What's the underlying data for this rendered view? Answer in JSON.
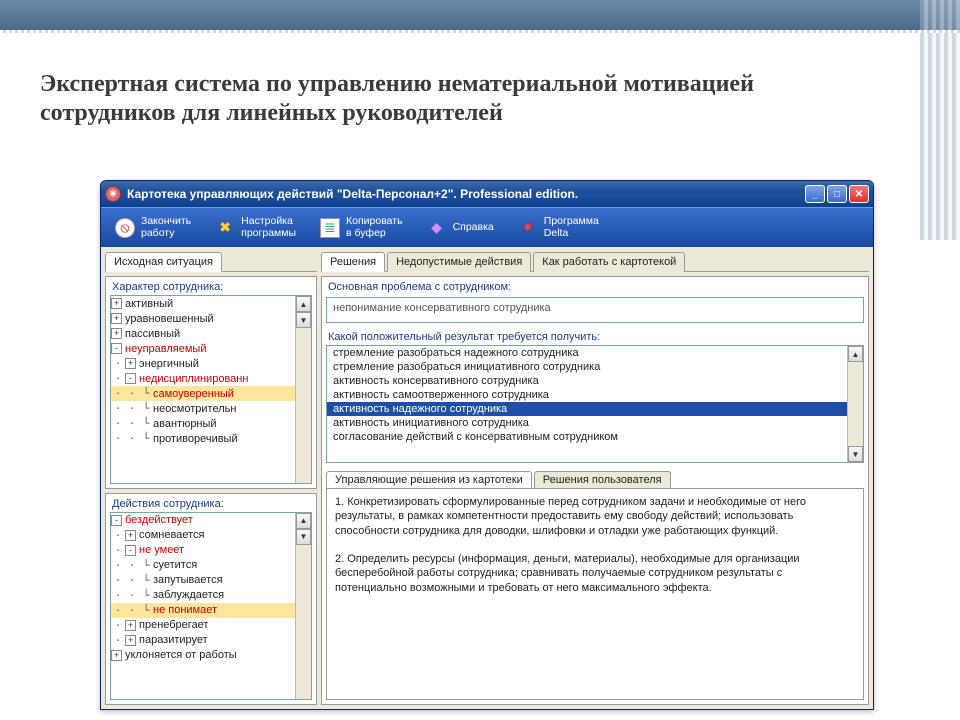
{
  "slide_title": "Экспертная система по управлению нематериальной мотивацией сотрудников для линейных руководителей",
  "window": {
    "title": "Картотека управляющих действий \"Delta-Персонал+2\". Professional edition.",
    "toolbar": [
      {
        "icon": "stop",
        "label": "Закончить\nработу"
      },
      {
        "icon": "gear",
        "label": "Настройка\nпрограммы"
      },
      {
        "icon": "doc",
        "label": "Копировать\nв буфер"
      },
      {
        "icon": "book",
        "label": "Справка"
      },
      {
        "icon": "star",
        "label": "Программа\nDelta"
      }
    ]
  },
  "left": {
    "tab": "Исходная ситуация",
    "sec1_label": "Характер сотрудника:",
    "tree1": [
      {
        "d": 0,
        "e": "+",
        "t": "активный"
      },
      {
        "d": 0,
        "e": "+",
        "t": "уравновешенный"
      },
      {
        "d": 0,
        "e": "+",
        "t": "пассивный"
      },
      {
        "d": 0,
        "e": "-",
        "t": "неуправляемый",
        "red": true
      },
      {
        "d": 1,
        "e": "+",
        "t": "энергичный"
      },
      {
        "d": 1,
        "e": "-",
        "t": "недисциплинированн",
        "red": true
      },
      {
        "d": 2,
        "e": "",
        "t": "самоуверенный",
        "sel": true,
        "red": true
      },
      {
        "d": 2,
        "e": "",
        "t": "неосмотрительн"
      },
      {
        "d": 2,
        "e": "",
        "t": "авантюрный"
      },
      {
        "d": 2,
        "e": "",
        "t": "противоречивый"
      }
    ],
    "sec2_label": "Действия сотрудника:",
    "tree2": [
      {
        "d": 0,
        "e": "-",
        "t": "бездействует",
        "red": true
      },
      {
        "d": 1,
        "e": "+",
        "t": "сомневается"
      },
      {
        "d": 1,
        "e": "-",
        "t": "не умеет",
        "red": true
      },
      {
        "d": 2,
        "e": "",
        "t": "суетится"
      },
      {
        "d": 2,
        "e": "",
        "t": "запутывается"
      },
      {
        "d": 2,
        "e": "",
        "t": "заблуждается"
      },
      {
        "d": 2,
        "e": "",
        "t": "не понимает",
        "sel": true,
        "red": true
      },
      {
        "d": 1,
        "e": "+",
        "t": "пренебрегает"
      },
      {
        "d": 1,
        "e": "+",
        "t": "паразитирует"
      },
      {
        "d": 0,
        "e": "+",
        "t": "уклоняется от работы"
      }
    ]
  },
  "right": {
    "tabs": [
      "Решения",
      "Недопустимые действия",
      "Как работать с картотекой"
    ],
    "active_tab": 0,
    "problem_label": "Основная проблема с сотрудником:",
    "problem_value": "непонимание консервативного сотрудника",
    "result_label": "Какой положительный результат требуется получить:",
    "result_items": [
      "стремление разобраться надежного сотрудника",
      "стремление разобраться инициативного сотрудника",
      "активность консервативного сотрудника",
      "активность самоотверженного сотрудника",
      "активность надежного сотрудника",
      "активность инициативного сотрудника",
      "согласование действий с консервативным сотрудником"
    ],
    "result_selected": 4,
    "subtabs": [
      "Управляющие решения из картотеки",
      "Решения пользователя"
    ],
    "subtab_active": 0,
    "solution": "1. Конкретизировать сформулированные перед сотрудником задачи и необходимые от него результаты, в рамках компетентности предоставить ему свободу действий; использовать способности сотрудника для доводки, шлифовки и отладки уже работающих функций.\n\n2. Определить ресурсы (информация, деньги, материалы), необходимые для организации бесперебойной работы сотрудника; сравнивать получаемые сотрудником результаты с потенциально возможными и требовать от него максимального эффекта."
  }
}
